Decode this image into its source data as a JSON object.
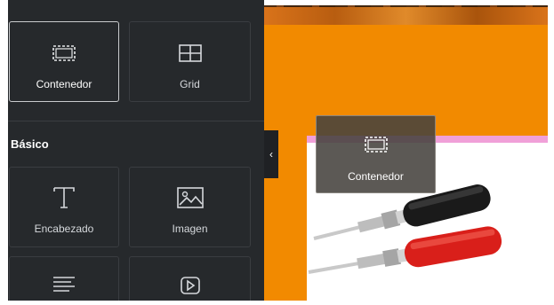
{
  "panel": {
    "layout_tiles": [
      {
        "label": "Contenedor",
        "icon": "container-icon"
      },
      {
        "label": "Grid",
        "icon": "grid-icon"
      }
    ],
    "section_title": "Básico",
    "basic_tiles": [
      {
        "label": "Encabezado",
        "icon": "heading-icon"
      },
      {
        "label": "Imagen",
        "icon": "image-icon"
      },
      {
        "label": "",
        "icon": "text-editor-icon"
      },
      {
        "label": "",
        "icon": "video-icon"
      }
    ],
    "collapse_icon": "chevron-left-icon",
    "collapse_glyph": "‹"
  },
  "drag_ghost": {
    "label": "Contenedor",
    "icon": "container-icon"
  },
  "canvas": {
    "image": "red-black-banana-plug-connectors",
    "accent_colors": {
      "background": "#f28a00",
      "drop_indicator": "#f0a0d8",
      "panel": "#26292c"
    }
  }
}
